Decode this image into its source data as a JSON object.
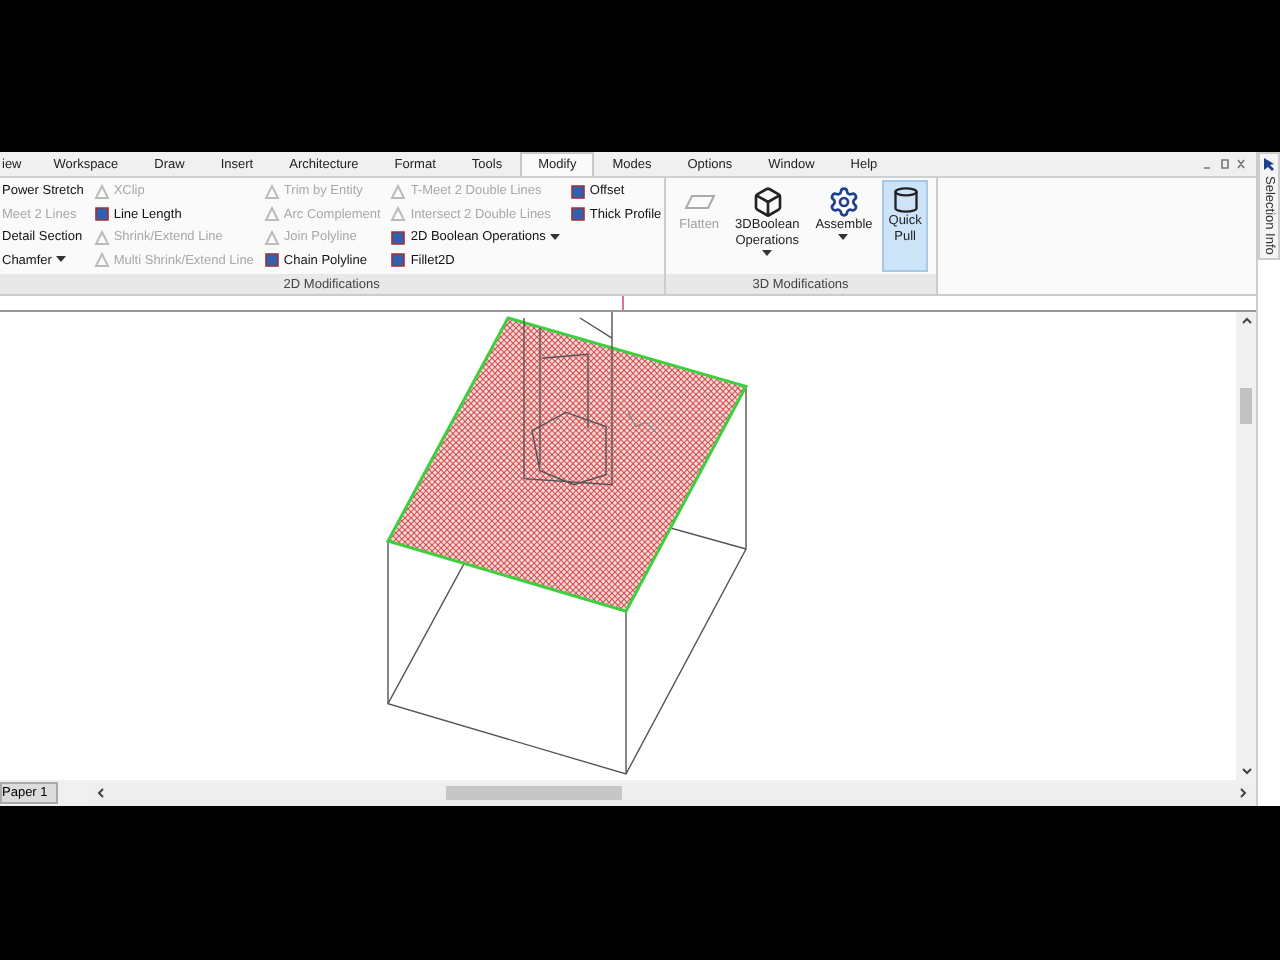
{
  "menu": {
    "tabs": [
      {
        "label": "iew",
        "selected": false
      },
      {
        "label": "Workspace",
        "selected": false
      },
      {
        "label": "Draw",
        "selected": false
      },
      {
        "label": "Insert",
        "selected": false
      },
      {
        "label": "Architecture",
        "selected": false
      },
      {
        "label": "Format",
        "selected": false
      },
      {
        "label": "Tools",
        "selected": false
      },
      {
        "label": "Modify",
        "selected": true
      },
      {
        "label": "Modes",
        "selected": false
      },
      {
        "label": "Options",
        "selected": false
      },
      {
        "label": "Window",
        "selected": false
      },
      {
        "label": "Help",
        "selected": false
      }
    ]
  },
  "ribbon": {
    "groups": [
      {
        "title": "2D Modifications",
        "kind": "small",
        "columns": [
          [
            {
              "label": "Power Stretch",
              "disabled": false,
              "dropdown": false
            },
            {
              "label": "Meet 2 Lines",
              "disabled": true,
              "dropdown": false
            },
            {
              "label": "Detail Section",
              "disabled": false,
              "dropdown": false
            },
            {
              "label": "Chamfer",
              "disabled": false,
              "dropdown": true
            }
          ],
          [
            {
              "label": "XClip",
              "disabled": true,
              "dropdown": false
            },
            {
              "label": "Line Length",
              "disabled": false,
              "dropdown": false
            },
            {
              "label": "Shrink/Extend Line",
              "disabled": true,
              "dropdown": false
            },
            {
              "label": "Multi Shrink/Extend Line",
              "disabled": true,
              "dropdown": false
            }
          ],
          [
            {
              "label": "Trim by Entity",
              "disabled": true,
              "dropdown": false
            },
            {
              "label": "Arc Complement",
              "disabled": true,
              "dropdown": false
            },
            {
              "label": "Join Polyline",
              "disabled": true,
              "dropdown": false
            },
            {
              "label": "Chain Polyline",
              "disabled": false,
              "dropdown": false
            }
          ],
          [
            {
              "label": "T-Meet 2 Double Lines",
              "disabled": true,
              "dropdown": false
            },
            {
              "label": "Intersect 2 Double Lines",
              "disabled": true,
              "dropdown": false
            },
            {
              "label": "2D Boolean Operations",
              "disabled": false,
              "dropdown": true
            },
            {
              "label": "Fillet2D",
              "disabled": false,
              "dropdown": false
            }
          ],
          [
            {
              "label": "Offset",
              "disabled": false,
              "dropdown": false
            },
            {
              "label": "Thick Profile",
              "disabled": false,
              "dropdown": false
            }
          ]
        ]
      },
      {
        "title": "3D Modifications",
        "kind": "large",
        "buttons": [
          {
            "label": "Flatten",
            "disabled": true,
            "selected": false,
            "dropdown": false
          },
          {
            "label": "3DBoolean\nOperations",
            "disabled": false,
            "selected": false,
            "dropdown": true
          },
          {
            "label": "Assemble",
            "disabled": false,
            "selected": false,
            "dropdown": true
          },
          {
            "label": "Quick\nPull",
            "disabled": false,
            "selected": true,
            "dropdown": false
          }
        ]
      }
    ]
  },
  "side_panel": {
    "title": "Selection Info"
  },
  "layout_tab": {
    "label": "Paper 1"
  }
}
